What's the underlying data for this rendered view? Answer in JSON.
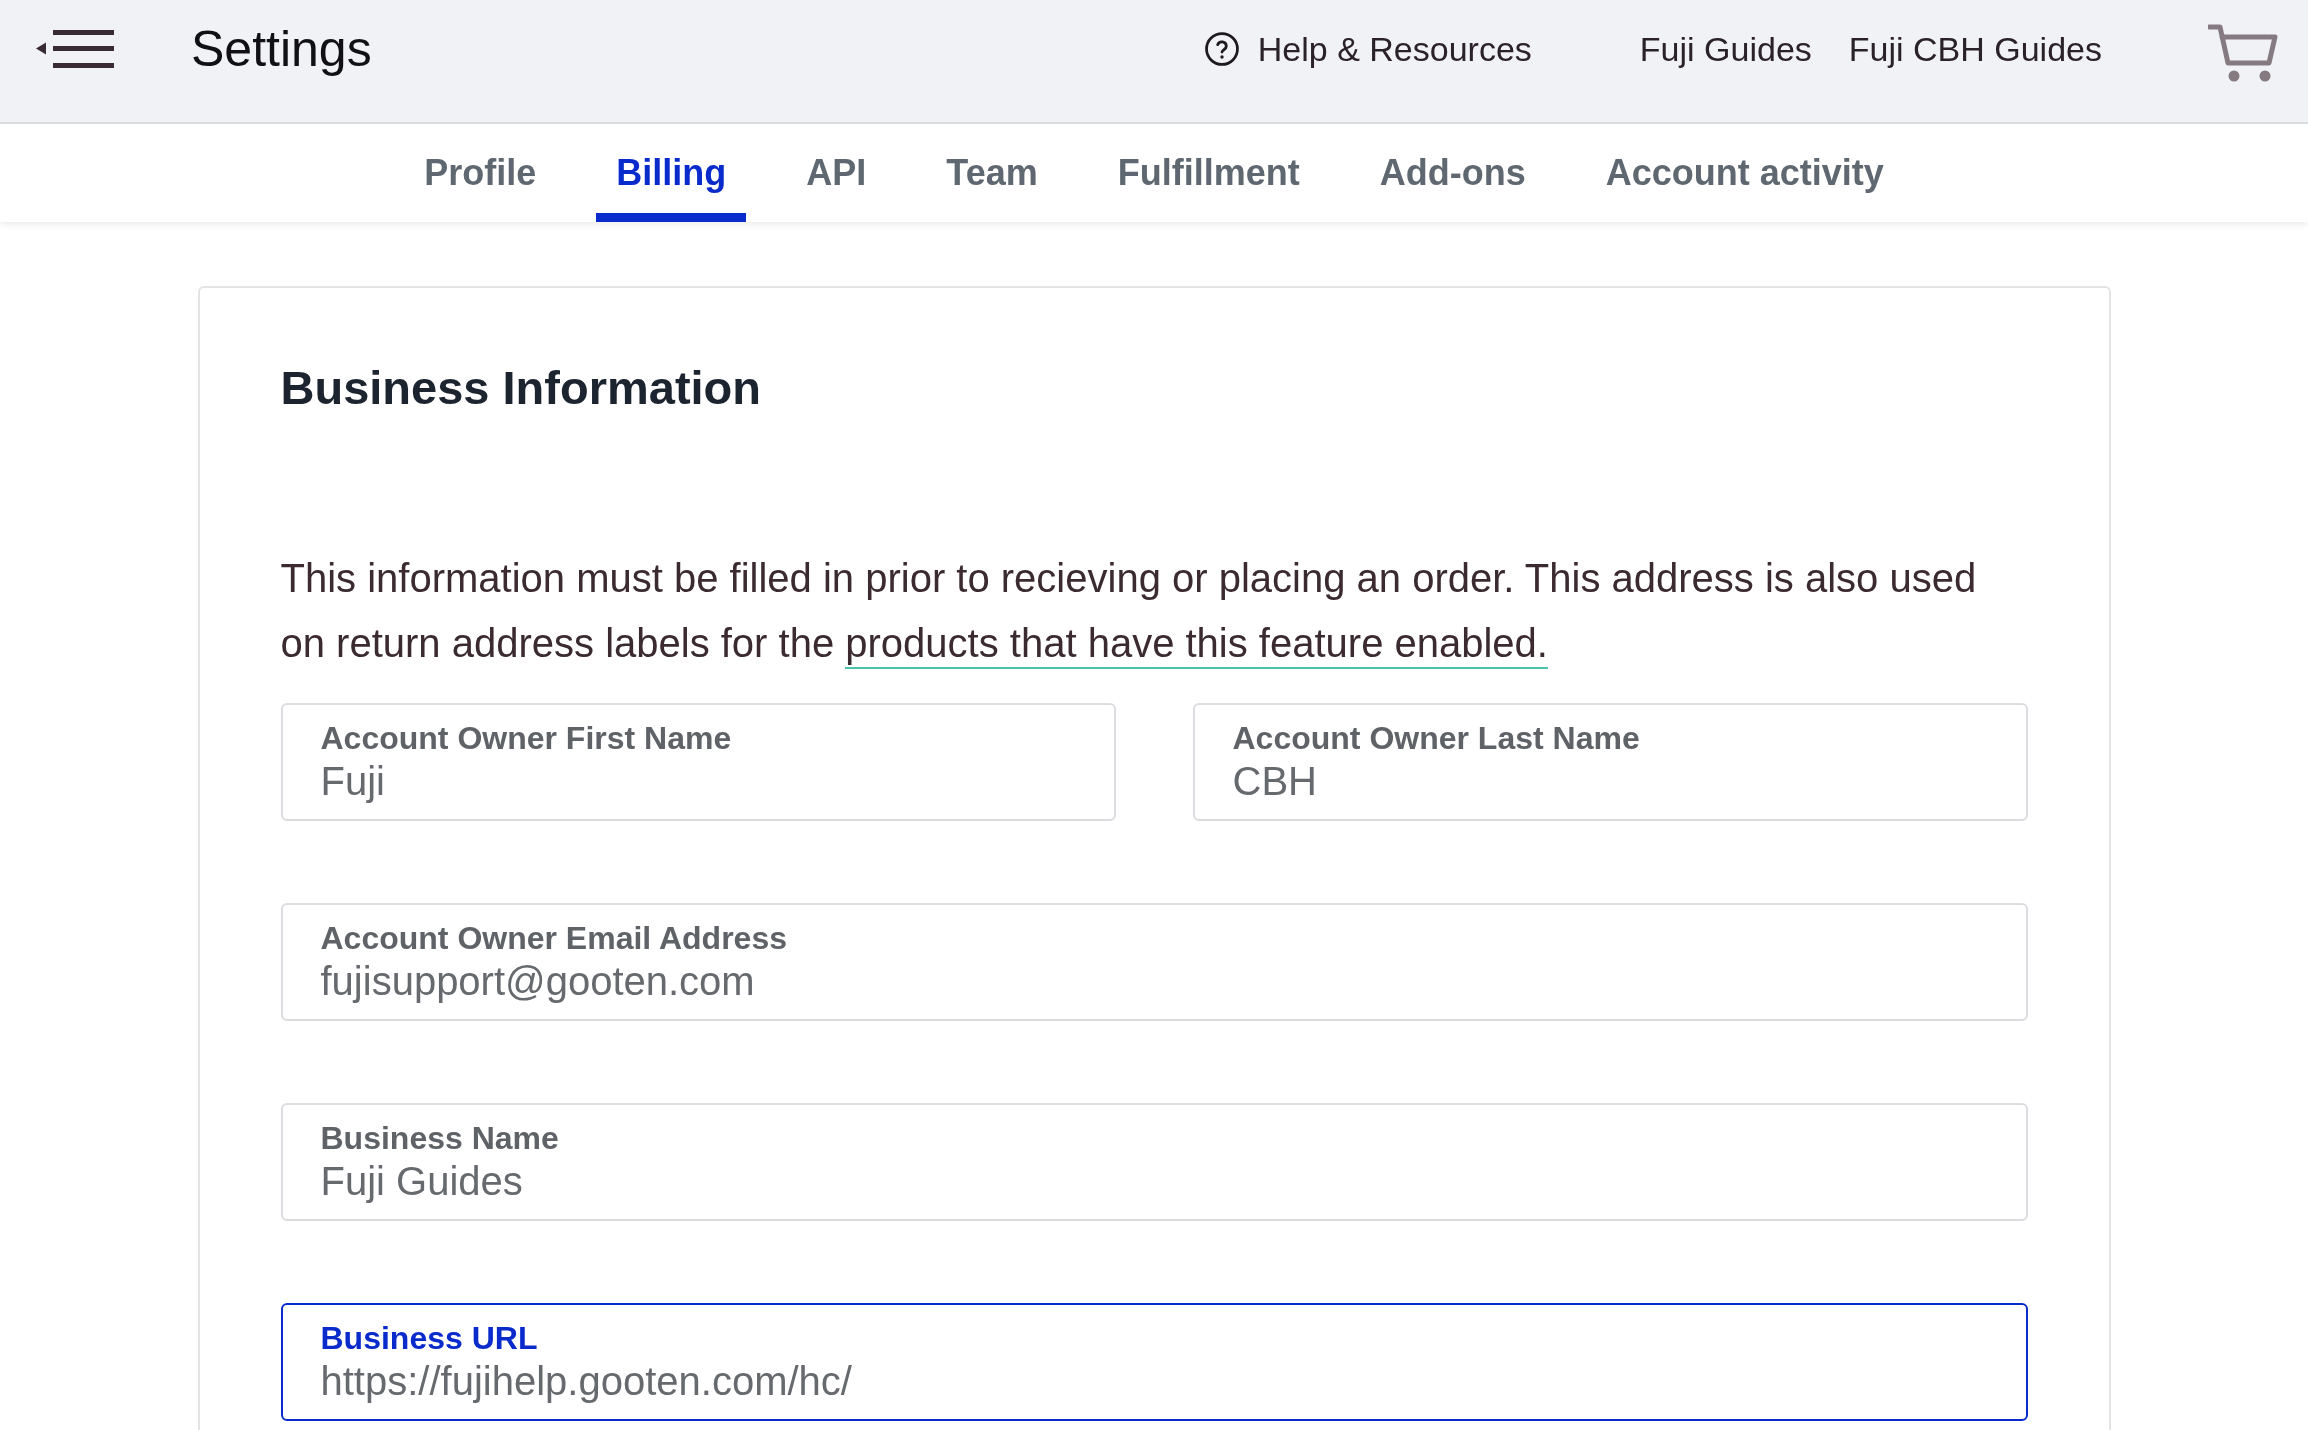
{
  "header": {
    "title": "Settings",
    "help_link": "Help & Resources",
    "links": [
      "Fuji Guides",
      "Fuji CBH Guides"
    ]
  },
  "tabs": [
    {
      "label": "Profile",
      "selected": false
    },
    {
      "label": "Billing",
      "selected": true
    },
    {
      "label": "API",
      "selected": false
    },
    {
      "label": "Team",
      "selected": false
    },
    {
      "label": "Fulfillment",
      "selected": false
    },
    {
      "label": "Add-ons",
      "selected": false
    },
    {
      "label": "Account activity",
      "selected": false
    }
  ],
  "section": {
    "title": "Business Information",
    "intro": "This information must be filled in prior to recieving or placing an order. This address is also used on return address labels for the",
    "intro_link": "products that have this feature enabled.",
    "rows": [
      [
        {
          "label": "Account Owner First Name",
          "value": "Fuji",
          "focused": false
        },
        {
          "label": "Account Owner Last Name",
          "value": "CBH",
          "focused": false
        }
      ],
      [
        {
          "label": "Account Owner Email Address",
          "value": "fujisupport@gooten.com",
          "focused": false
        }
      ],
      [
        {
          "label": "Business Name",
          "value": "Fuji Guides",
          "focused": false
        }
      ],
      [
        {
          "label": "Business URL",
          "value": "https://fujihelp.gooten.com/hc/",
          "focused": true
        }
      ]
    ]
  }
}
